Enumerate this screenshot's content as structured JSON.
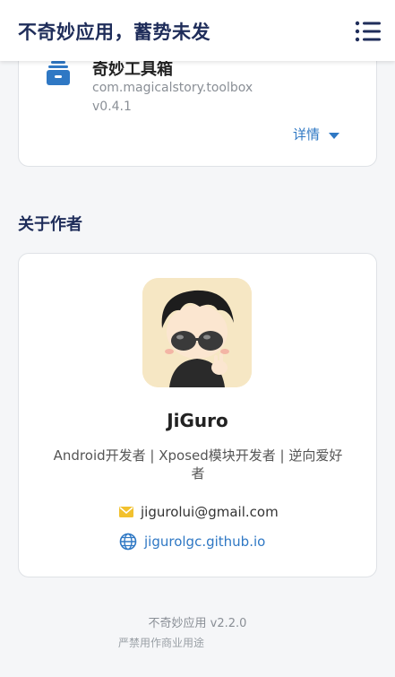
{
  "header": {
    "title": "不奇妙应用，蓄势未发",
    "menu_icon": "list-menu-icon"
  },
  "app_card": {
    "name": "奇妙工具箱",
    "package": "com.magicalstory.toolbox",
    "version": "v0.4.1",
    "details_label": "详情",
    "icon": "toolbox-icon",
    "icon_color": "#2f78c4"
  },
  "author_section": {
    "title": "关于作者",
    "name": "JiGuro",
    "bio": "Android开发者 | Xposed模块开发者 | 逆向爱好者",
    "email": "jigurolui@gmail.com",
    "website": "jigurolgc.github.io",
    "email_icon_color": "#f2c12e",
    "link_color": "#2f78c4"
  },
  "footer": {
    "version": "不奇妙应用 v2.2.0",
    "note": "严禁用作商业用途"
  }
}
